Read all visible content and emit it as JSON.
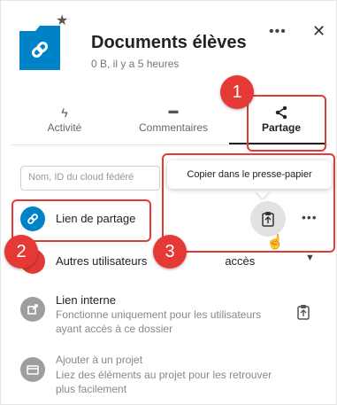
{
  "header": {
    "title": "Documents élèves",
    "subtitle": "0 B, il y a 5 heures",
    "more_label": "•••",
    "close_label": "✕",
    "folder_icon": "folder-link-icon",
    "star_icon": "star-icon"
  },
  "tabs": [
    {
      "label": "Activité",
      "icon": "lightning-icon",
      "glyph": "ϟ"
    },
    {
      "label": "Commentaires",
      "icon": "comment-icon",
      "glyph": "▬"
    },
    {
      "label": "Partage",
      "icon": "share-icon",
      "glyph": "<",
      "active": true
    }
  ],
  "search": {
    "placeholder": "Nom, ID du cloud fédéré"
  },
  "tooltip": {
    "text": "Copier dans le presse-papier"
  },
  "share_link": {
    "label": "Lien de partage",
    "more_label": "•••"
  },
  "other_users": {
    "label": "Autres utilisateurs",
    "suffix": "accès",
    "caret": "▼"
  },
  "internal_link": {
    "title": "Lien interne",
    "description": "Fonctionne uniquement pour les utilisateurs ayant accès à ce dossier"
  },
  "add_project": {
    "title": "Ajouter à un projet",
    "description": "Liez des éléments au projet pour les retrouver plus facilement"
  },
  "callouts": [
    "1",
    "2",
    "3"
  ],
  "colors": {
    "accent": "#0082c9",
    "callout": "#e53935",
    "muted_icon": "#9e9e9e"
  }
}
